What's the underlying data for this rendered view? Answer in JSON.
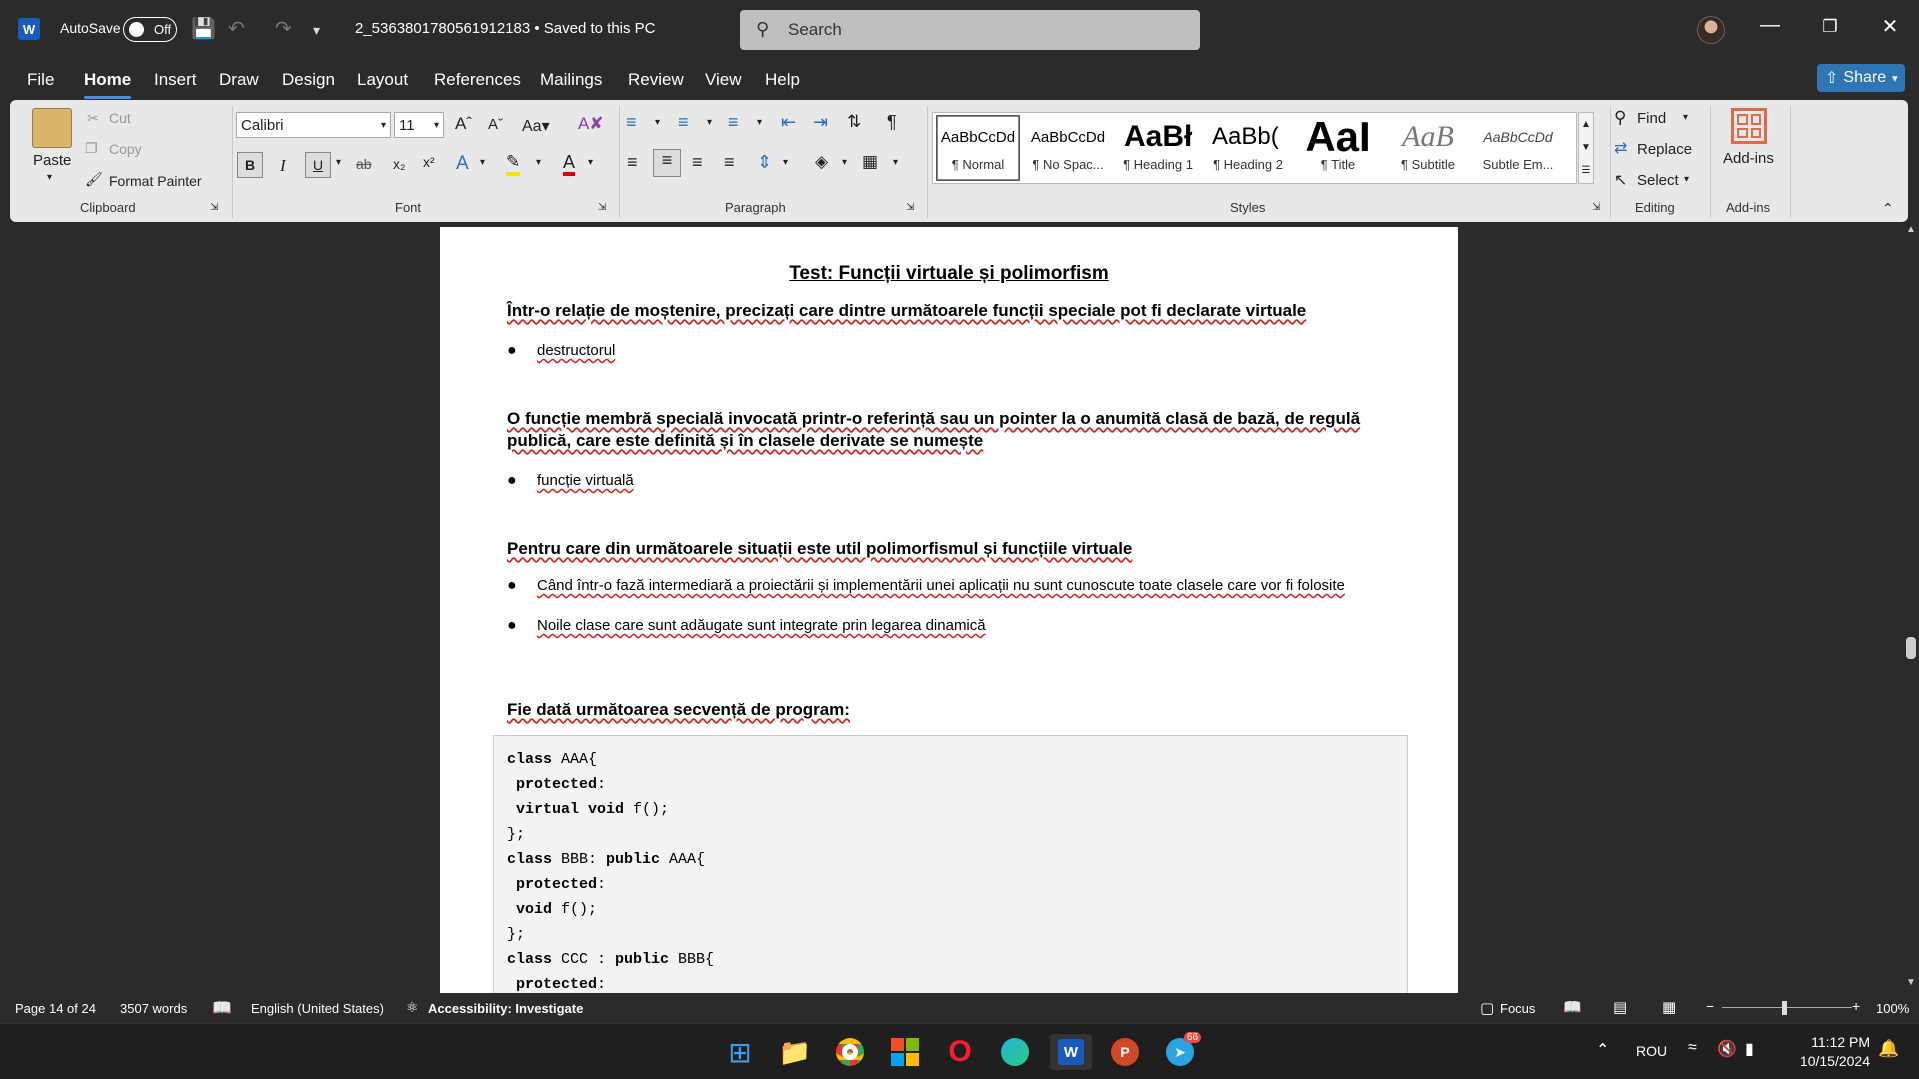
{
  "titlebar": {
    "autosave_label": "AutoSave",
    "toggle_state": "Off",
    "doc_name": "2_5363801780561912183 • Saved to this PC",
    "search_placeholder": "Search"
  },
  "menu": [
    "File",
    "Home",
    "Insert",
    "Draw",
    "Design",
    "Layout",
    "References",
    "Mailings",
    "Review",
    "View",
    "Help"
  ],
  "share_label": "Share",
  "ribbon": {
    "clipboard": {
      "paste": "Paste",
      "cut": "Cut",
      "copy": "Copy",
      "format_painter": "Format Painter",
      "group": "Clipboard"
    },
    "font": {
      "family": "Calibri",
      "size": "11",
      "group": "Font"
    },
    "paragraph": {
      "group": "Paragraph"
    },
    "styles": {
      "group": "Styles",
      "items": [
        {
          "sample": "AaBbCcDd",
          "name": "¶ Normal"
        },
        {
          "sample": "AaBbCcDd",
          "name": "¶ No Spac..."
        },
        {
          "sample": "AaBł",
          "name": "¶ Heading 1"
        },
        {
          "sample": "AaBb(",
          "name": "¶ Heading 2"
        },
        {
          "sample": "AaI",
          "name": "¶ Title"
        },
        {
          "sample": "AaB",
          "name": "¶ Subtitle"
        },
        {
          "sample": "AaBbCcDd",
          "name": "Subtle Em..."
        }
      ]
    },
    "editing": {
      "find": "Find",
      "replace": "Replace",
      "select": "Select",
      "group": "Editing"
    },
    "addins": {
      "label": "Add-ins",
      "group": "Add-ins"
    }
  },
  "document": {
    "title": "Test: Funcții virtuale și polimorfism",
    "q1": "Într-o relație de moștenire, precizați care dintre următoarele funcții speciale pot fi declarate virtuale",
    "a1": "destructorul",
    "q2": "O funcție membră specială invocată printr-o referință sau un pointer la o anumită clasă de bază, de regulă publică, care este definită și în clasele derivate se numește",
    "a2": "funcție virtuală",
    "q3": "Pentru care din următoarele situații este util polimorfismul și funcțiile virtuale",
    "a3a": "Când într-o fază intermediară a proiectării și implementării unei aplicații nu sunt cunoscute toate clasele care vor fi folosite",
    "a3b": "Noile clase care sunt adăugate sunt integrate prin legarea dinamică",
    "q4": "Fie dată următoarea secvență de program:",
    "code": [
      {
        "kw": "class",
        "rest": " AAA{"
      },
      {
        "kw": " protected",
        "rest": ":"
      },
      {
        "kw": " virtual void",
        "rest": " f();"
      },
      {
        "kw": "",
        "rest": "};"
      },
      {
        "kw": "class",
        "rest": " BBB: ",
        "kw2": "public",
        "rest2": " AAA{"
      },
      {
        "kw": " protected",
        "rest": ":"
      },
      {
        "kw": " void",
        "rest": " f();"
      },
      {
        "kw": "",
        "rest": "};"
      },
      {
        "kw": "class",
        "rest": " CCC : ",
        "kw2": "public",
        "rest2": " BBB{"
      },
      {
        "kw": " protected",
        "rest": ":"
      }
    ]
  },
  "status": {
    "page": "Page 14 of 24",
    "words": "3507 words",
    "language": "English (United States)",
    "accessibility": "Accessibility: Investigate",
    "focus": "Focus",
    "zoom": "100%"
  },
  "taskbar": {
    "lang": "ROU",
    "time": "11:12 PM",
    "date": "10/15/2024",
    "badge": "66"
  }
}
